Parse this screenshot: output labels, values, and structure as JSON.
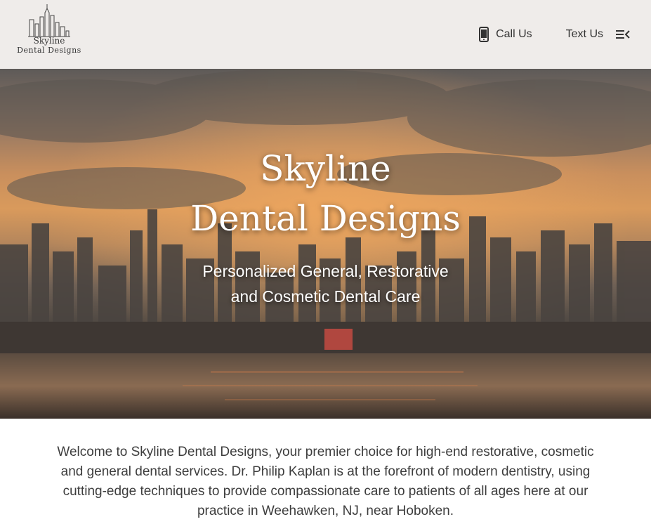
{
  "header": {
    "logo": {
      "line1": "Skyline",
      "line2": "Dental Designs",
      "icon": "city-skyline-logo"
    },
    "nav": {
      "call_label": "Call Us",
      "call_icon": "mobile-phone-icon",
      "text_label": "Text Us",
      "menu_icon": "menu-icon"
    }
  },
  "hero": {
    "title_line1": "Skyline",
    "title_line2": "Dental Designs",
    "subtitle_line1": "Personalized General, Restorative",
    "subtitle_line2": "and Cosmetic Dental Care"
  },
  "intro": {
    "text": "Welcome to Skyline Dental Designs, your premier choice for high-end restorative, cosmetic and general dental services. Dr. Philip Kaplan is at the forefront of modern dentistry, using cutting-edge techniques to provide compassionate care to patients of all ages here at our practice in Weehawken, NJ, near Hoboken."
  },
  "colors": {
    "header_bg": "#efecea",
    "text": "#3d3d3d",
    "hero_text": "#ffffff",
    "sky_glow": "#d99a5c"
  }
}
